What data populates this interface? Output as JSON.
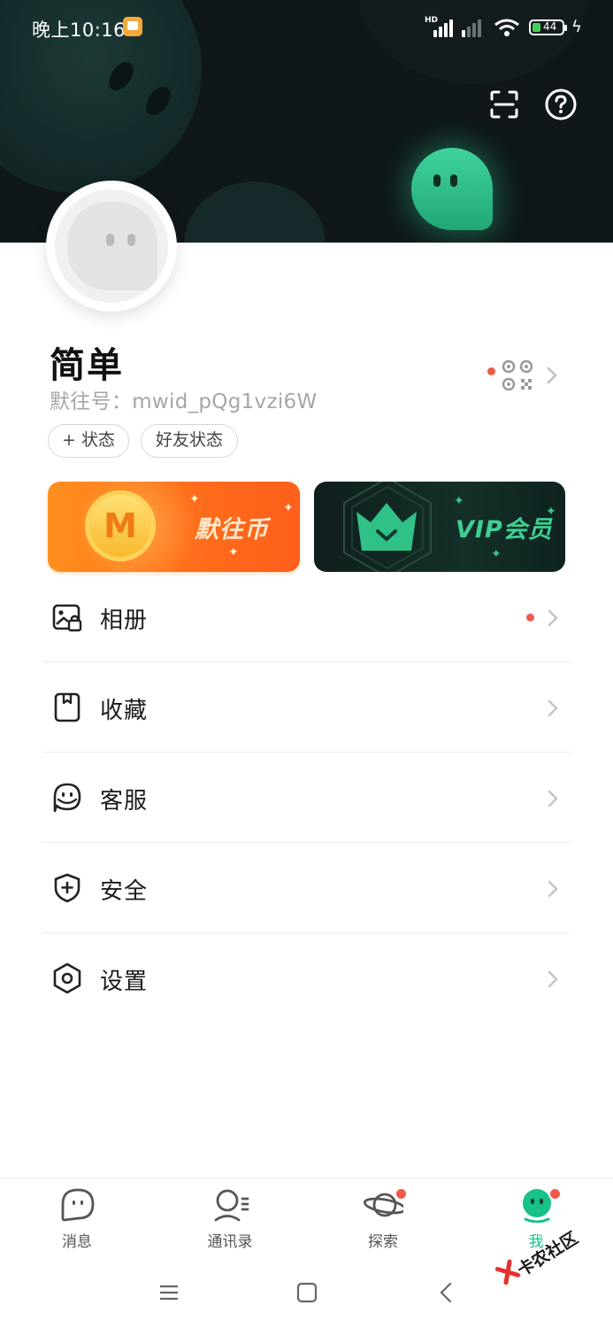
{
  "status_bar": {
    "time": "晚上10:16",
    "battery": "44",
    "net_label": "HD"
  },
  "header": {
    "scan_icon": "scan-icon",
    "help_icon": "help-icon"
  },
  "profile": {
    "nickname": "简单",
    "account_id": "默往号：mwid_pQg1vzi6W",
    "status_chip": "+ 状态",
    "friend_status_chip": "好友状态"
  },
  "promo": {
    "coin_label": "默往币",
    "coin_letter": "M",
    "vip_label": "VIP会员",
    "colors": {
      "coin": "#ff7a1e",
      "vip": "#3fcf92"
    }
  },
  "menu": [
    {
      "label": "相册",
      "icon": "photo-album-icon",
      "has_dot": true
    },
    {
      "label": "收藏",
      "icon": "bookmark-icon",
      "has_dot": false
    },
    {
      "label": "客服",
      "icon": "customer-service-icon",
      "has_dot": false
    },
    {
      "label": "安全",
      "icon": "shield-icon",
      "has_dot": false
    },
    {
      "label": "设置",
      "icon": "settings-hexagon-icon",
      "has_dot": false
    }
  ],
  "tabs": [
    {
      "label": "消息",
      "icon": "message-ghost-icon",
      "active": false,
      "badge": false
    },
    {
      "label": "通讯录",
      "icon": "contacts-icon",
      "active": false,
      "badge": false
    },
    {
      "label": "探索",
      "icon": "planet-icon",
      "active": false,
      "badge": true
    },
    {
      "label": "我",
      "icon": "me-ghost-icon",
      "active": true,
      "badge": true
    }
  ],
  "accent_color": "#18c08a",
  "badge_color": "#f05a4b",
  "watermark": "卡农社区"
}
